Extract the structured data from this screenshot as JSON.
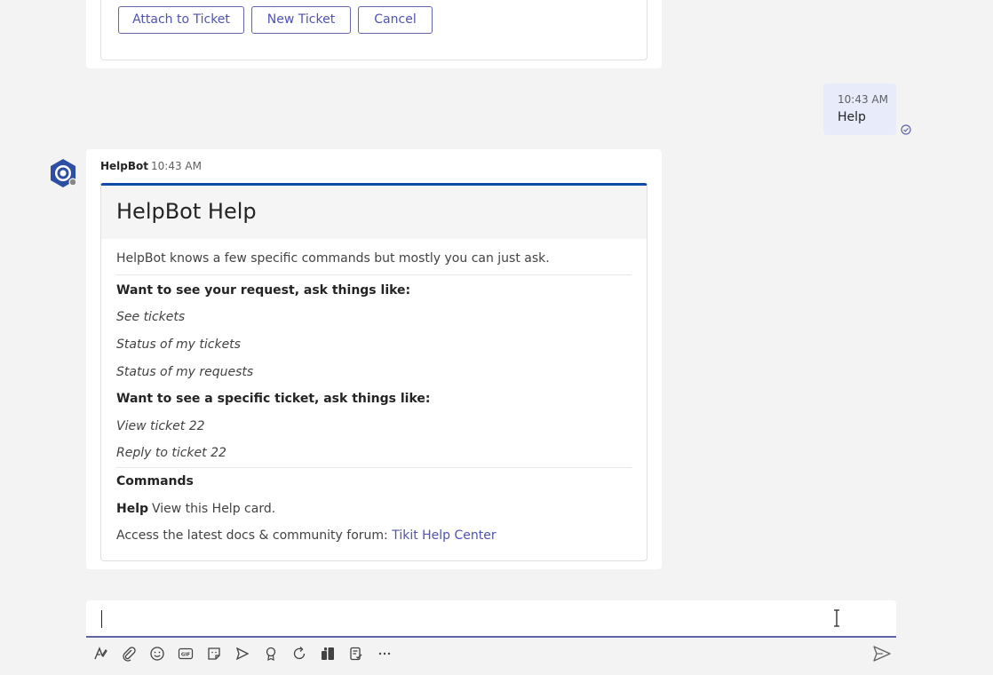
{
  "previous_card": {
    "buttons": [
      "Attach to Ticket",
      "New Ticket",
      "Cancel"
    ]
  },
  "my_message": {
    "time": "10:43 AM",
    "text": "Help"
  },
  "bot_message": {
    "sender": "HelpBot",
    "time": "10:43 AM",
    "card": {
      "title": "HelpBot Help",
      "intro": "HelpBot knows a few specific commands but mostly you can just ask.",
      "section1_heading": "Want to see your request, ask things like:",
      "section1_examples": [
        "See tickets",
        "Status of my tickets",
        "Status of my requests"
      ],
      "section2_heading": "Want to see a specific ticket, ask things like:",
      "section2_examples": [
        "View ticket 22",
        "Reply to ticket 22"
      ],
      "commands_heading": "Commands",
      "command_name": "Help",
      "command_desc": "View this Help card.",
      "footer_text": "Access the latest docs & community forum: ",
      "footer_link": "Tikit Help Center"
    }
  },
  "compose": {
    "value": "",
    "tools": [
      "format-icon",
      "attach-icon",
      "emoji-icon",
      "gif-icon",
      "sticker-icon",
      "meet-icon",
      "praise-icon",
      "loop-icon",
      "apps-icon",
      "approvals-icon",
      "more-icon"
    ],
    "send_icon": "send-icon"
  },
  "colors": {
    "accent": "#6264a7",
    "card_border_top": "#0f4ca8",
    "my_bubble": "#e8ebfa",
    "link": "#4f52b2"
  }
}
